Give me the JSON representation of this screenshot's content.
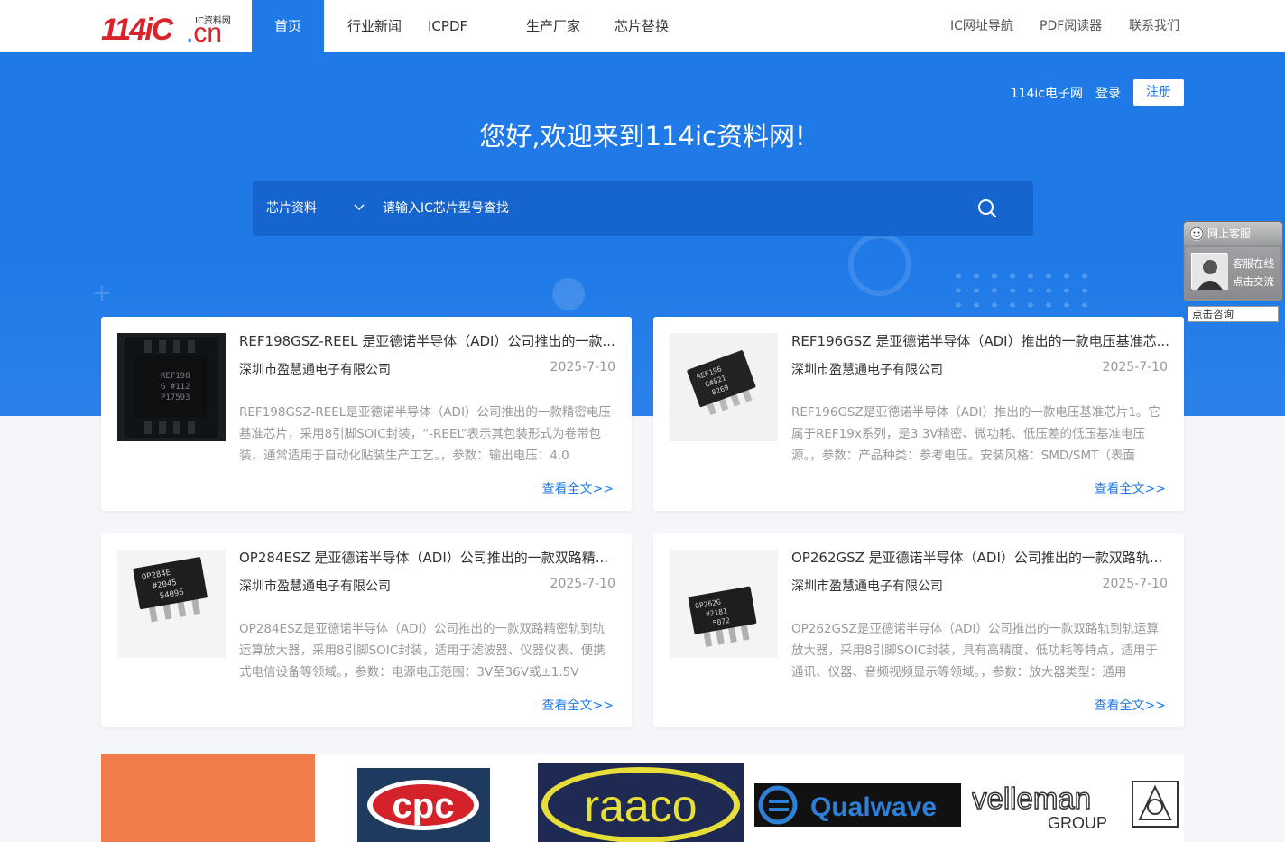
{
  "logo": {
    "main": "114iC",
    "suffix_dot": ".",
    "suffix": "cn",
    "tag": "IC资料网"
  },
  "nav": {
    "items": [
      "首页",
      "行业新闻",
      "ICPDF",
      "生产厂家",
      "芯片替换"
    ],
    "right": [
      "IC网址导航",
      "PDF阅读器",
      "联系我们"
    ]
  },
  "hero": {
    "links": {
      "site": "114ic电子网",
      "login": "登录",
      "register": "注册"
    },
    "title": "您好,欢迎来到114ic资料网!",
    "search": {
      "category": "芯片资料",
      "placeholder": "请输入IC芯片型号查找"
    }
  },
  "articles": [
    {
      "title": "REF198GSZ-REEL 是亚德诺半导体（ADI）公司推出的一款...",
      "company": "深圳市盈慧通电子有限公司",
      "date": "2025-7-10",
      "summary": "REF198GSZ-REEL是亚德诺半导体（ADI）公司推出的一款精密电压基准芯片，采用8引脚SOIC封装，“-REEL”表示其包装形式为卷带包装，通常适用于自动化贴装生产工艺。，参数：输出电压：4.0",
      "more": "查看全文>>",
      "chip_text": [
        "REF198",
        "G #112",
        "P17593"
      ]
    },
    {
      "title": "REF196GSZ 是亚德诺半导体（ADI）推出的一款电压基准芯...",
      "company": "深圳市盈慧通电子有限公司",
      "date": "2025-7-10",
      "summary": "REF196GSZ是亚德诺半导体（ADI）推出的一款电压基准芯片1。它属于REF19x系列，是3.3V精密、微功耗、低压差的低压基准电压源。，参数：产品种类：参考电压。安装风格：SMD/SMT（表面",
      "more": "查看全文>>",
      "chip_text": [
        "REF196",
        "G#821",
        "8269"
      ]
    },
    {
      "title": "OP284ESZ 是亚德诺半导体（ADI）公司推出的一款双路精...",
      "company": "深圳市盈慧通电子有限公司",
      "date": "2025-7-10",
      "summary": "OP284ESZ是亚德诺半导体（ADI）公司推出的一款双路精密轨到轨运算放大器，采用8引脚SOIC封装，适用于滤波器、仪器仪表、便携式电信设备等领域。，参数：电源电压范围：3V至36V或±1.5V",
      "more": "查看全文>>",
      "chip_text": [
        "OP284E",
        "#2045",
        "54096"
      ]
    },
    {
      "title": "OP262GSZ 是亚德诺半导体（ADI）公司推出的一款双路轨...",
      "company": "深圳市盈慧通电子有限公司",
      "date": "2025-7-10",
      "summary": "OP262GSZ是亚德诺半导体（ADI）公司推出的一款双路轨到轨运算放大器，采用8引脚SOIC封装，具有高精度、低功耗等特点，适用于通讯、仪器、音频视频显示等领域。，参数：放大器类型：通用",
      "more": "查看全文>>",
      "chip_text": [
        "OP262G",
        "#2181",
        "5072"
      ]
    }
  ],
  "brands": [
    "cpc",
    "raaco",
    "Qualwave",
    "velleman",
    "GROUP"
  ],
  "chat": {
    "title": "网上客服",
    "line1": "客服在线",
    "line2": "点击交流",
    "consult": "点击咨询"
  },
  "colors": {
    "primary": "#1f7ae8",
    "logo_red": "#d9232a"
  }
}
